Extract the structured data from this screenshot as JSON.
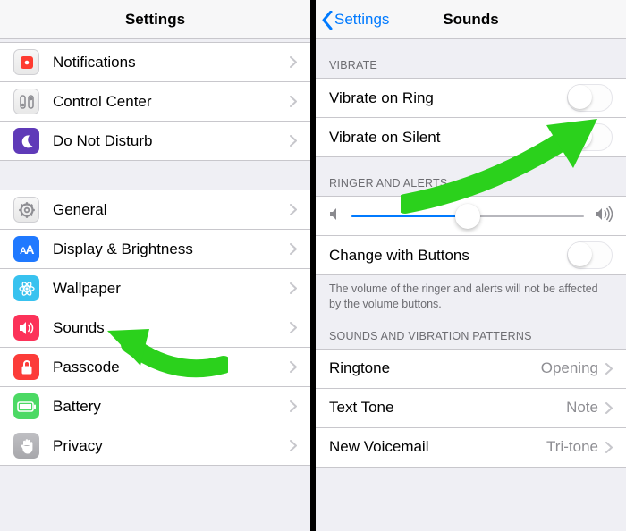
{
  "left": {
    "nav_title": "Settings",
    "group1": [
      {
        "icon": "notifications",
        "iconColor": "#fe3b30",
        "iconBg": "linear-gradient(#f7f7f7,#e8e8e8)",
        "iconBorder": "1px solid #cfcfd3",
        "label": "Notifications"
      },
      {
        "icon": "control-center",
        "iconColor": "#8e8e93",
        "iconBg": "linear-gradient(#f7f7f7,#e8e8e8)",
        "iconBorder": "1px solid #cfcfd3",
        "label": "Control Center"
      },
      {
        "icon": "moon",
        "iconColor": "#ffffff",
        "iconBg": "#5f3ab8",
        "label": "Do Not Disturb"
      }
    ],
    "group2": [
      {
        "icon": "gear",
        "iconColor": "#8e8e93",
        "iconBg": "linear-gradient(#f7f7f7,#e8e8e8)",
        "iconBorder": "1px solid #cfcfd3",
        "label": "General"
      },
      {
        "icon": "AA",
        "iconColor": "#ffffff",
        "iconBg": "#2079ff",
        "label": "Display & Brightness"
      },
      {
        "icon": "atom",
        "iconColor": "#ffffff",
        "iconBg": "#38c2ef",
        "label": "Wallpaper"
      },
      {
        "icon": "speaker",
        "iconColor": "#ffffff",
        "iconBg": "#fc3259",
        "label": "Sounds"
      },
      {
        "icon": "lock",
        "iconColor": "#ffffff",
        "iconBg": "#fc3c39",
        "label": "Passcode"
      },
      {
        "icon": "battery",
        "iconColor": "#ffffff",
        "iconBg": "#4cd964",
        "label": "Battery"
      },
      {
        "icon": "hand",
        "iconColor": "#ffffff",
        "iconBg": "linear-gradient(#bfbfc3,#a7a7ab)",
        "label": "Privacy"
      }
    ]
  },
  "right": {
    "nav_back": "Settings",
    "nav_title": "Sounds",
    "vibrate_header": "Vibrate",
    "vibrate_rows": [
      {
        "label": "Vibrate on Ring",
        "on": false
      },
      {
        "label": "Vibrate on Silent",
        "on": false
      }
    ],
    "ringer_header": "Ringer and Alerts",
    "change_with_buttons": {
      "label": "Change with Buttons",
      "on": false
    },
    "ringer_footer": "The volume of the ringer and alerts will not be affected by the volume buttons.",
    "patterns_header": "Sounds and Vibration Patterns",
    "pattern_rows": [
      {
        "label": "Ringtone",
        "value": "Opening"
      },
      {
        "label": "Text Tone",
        "value": "Note"
      },
      {
        "label": "New Voicemail",
        "value": "Tri-tone"
      }
    ]
  }
}
